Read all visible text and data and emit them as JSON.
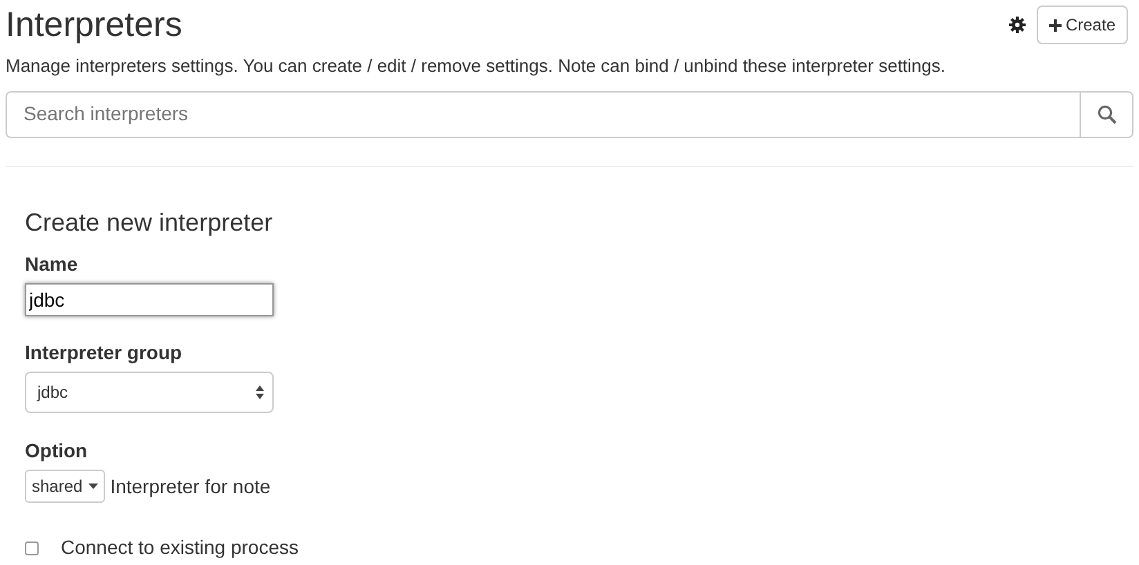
{
  "header": {
    "title": "Interpreters",
    "create_button": "Create",
    "description": "Manage interpreters settings. You can create / edit / remove settings. Note can bind / unbind these interpreter settings."
  },
  "search": {
    "placeholder": "Search interpreters"
  },
  "form": {
    "heading": "Create new interpreter",
    "name": {
      "label": "Name",
      "value": "jdbc"
    },
    "group": {
      "label": "Interpreter group",
      "value": "jdbc"
    },
    "option": {
      "label": "Option",
      "value": "shared",
      "text": "Interpreter for note"
    },
    "connect": {
      "label": "Connect to existing process",
      "checked": false
    }
  }
}
